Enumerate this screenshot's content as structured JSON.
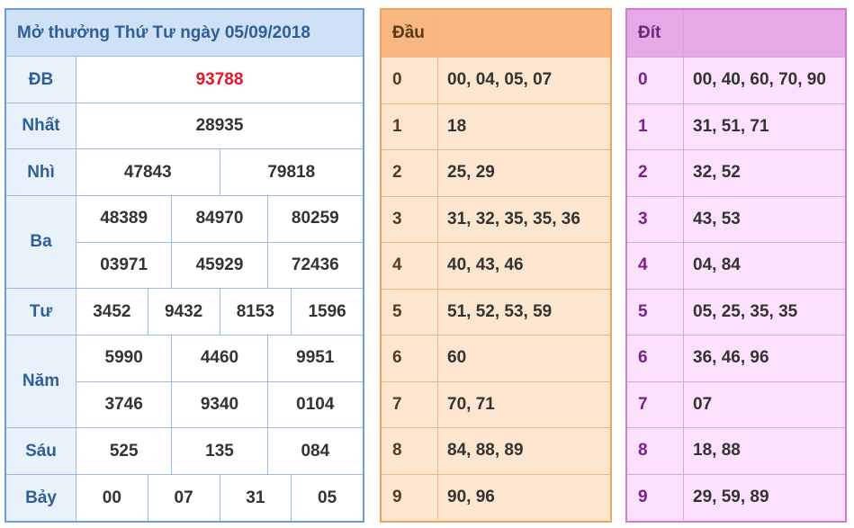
{
  "results": {
    "title": "Mở thưởng Thứ Tư ngày 05/09/2018",
    "rows": [
      {
        "label": "ĐB",
        "values": [
          "93788"
        ]
      },
      {
        "label": "Nhất",
        "values": [
          "28935"
        ]
      },
      {
        "label": "Nhì",
        "values": [
          "47843",
          "79818"
        ]
      },
      {
        "label": "Ba",
        "values": [
          "48389",
          "84970",
          "80259",
          "03971",
          "45929",
          "72436"
        ]
      },
      {
        "label": "Tư",
        "values": [
          "3452",
          "9432",
          "8153",
          "1596"
        ]
      },
      {
        "label": "Năm",
        "values": [
          "5990",
          "4460",
          "9951",
          "3746",
          "9340",
          "0104"
        ]
      },
      {
        "label": "Sáu",
        "values": [
          "525",
          "135",
          "084"
        ]
      },
      {
        "label": "Bảy",
        "values": [
          "00",
          "07",
          "31",
          "05"
        ]
      }
    ]
  },
  "dau": {
    "header": "Đầu",
    "rows": [
      {
        "k": "0",
        "v": "00, 04, 05, 07"
      },
      {
        "k": "1",
        "v": "18"
      },
      {
        "k": "2",
        "v": "25, 29"
      },
      {
        "k": "3",
        "v": "31, 32, 35, 35, 36"
      },
      {
        "k": "4",
        "v": "40, 43, 46"
      },
      {
        "k": "5",
        "v": "51, 52, 53, 59"
      },
      {
        "k": "6",
        "v": "60"
      },
      {
        "k": "7",
        "v": "70, 71"
      },
      {
        "k": "8",
        "v": "84, 88, 89"
      },
      {
        "k": "9",
        "v": "90, 96"
      }
    ]
  },
  "dit": {
    "header": "Đít",
    "rows": [
      {
        "k": "0",
        "v": "00, 40, 60, 70, 90"
      },
      {
        "k": "1",
        "v": "31, 51, 71"
      },
      {
        "k": "2",
        "v": "32, 52"
      },
      {
        "k": "3",
        "v": "43, 53"
      },
      {
        "k": "4",
        "v": "04, 84"
      },
      {
        "k": "5",
        "v": "05, 25, 35, 35"
      },
      {
        "k": "6",
        "v": "36, 46, 96"
      },
      {
        "k": "7",
        "v": "07"
      },
      {
        "k": "8",
        "v": "18, 88"
      },
      {
        "k": "9",
        "v": "29, 59, 89"
      }
    ]
  },
  "colors": {
    "special_prize": "#e8142b",
    "results_border": "#6b9be6",
    "dau_border": "#f0a15d",
    "dit_border": "#d47ad4"
  }
}
